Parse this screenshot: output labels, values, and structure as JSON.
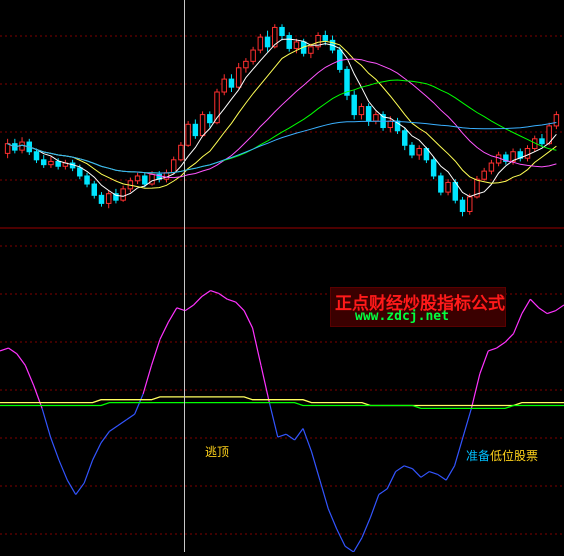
{
  "chart_data": [
    {
      "type": "candlestick",
      "panel": "price",
      "candles": [
        {
          "o": 1.0,
          "c": 1.6,
          "h": 1.9,
          "l": 0.7
        },
        {
          "o": 1.6,
          "c": 1.2,
          "h": 1.9,
          "l": 1.0
        },
        {
          "o": 1.2,
          "c": 1.7,
          "h": 2.0,
          "l": 1.0
        },
        {
          "o": 1.7,
          "c": 1.1,
          "h": 1.9,
          "l": 0.9
        },
        {
          "o": 1.1,
          "c": 0.6,
          "h": 1.3,
          "l": 0.4
        },
        {
          "o": 0.6,
          "c": 0.3,
          "h": 0.9,
          "l": 0.1
        },
        {
          "o": 0.3,
          "c": 0.5,
          "h": 0.8,
          "l": 0.1
        },
        {
          "o": 0.5,
          "c": 0.2,
          "h": 0.7,
          "l": 0.0
        },
        {
          "o": 0.2,
          "c": 0.4,
          "h": 0.6,
          "l": 0.0
        },
        {
          "o": 0.4,
          "c": 0.1,
          "h": 0.6,
          "l": -0.1
        },
        {
          "o": 0.1,
          "c": -0.4,
          "h": 0.3,
          "l": -0.6
        },
        {
          "o": -0.4,
          "c": -0.9,
          "h": -0.2,
          "l": -1.1
        },
        {
          "o": -0.9,
          "c": -1.6,
          "h": -0.7,
          "l": -1.8
        },
        {
          "o": -1.6,
          "c": -2.1,
          "h": -1.4,
          "l": -2.3
        },
        {
          "o": -2.1,
          "c": -1.5,
          "h": -1.3,
          "l": -2.4
        },
        {
          "o": -1.5,
          "c": -1.9,
          "h": -1.2,
          "l": -2.1
        },
        {
          "o": -1.9,
          "c": -1.2,
          "h": -1.0,
          "l": -2.0
        },
        {
          "o": -1.2,
          "c": -0.7,
          "h": -0.5,
          "l": -1.4
        },
        {
          "o": -0.7,
          "c": -0.4,
          "h": -0.2,
          "l": -0.9
        },
        {
          "o": -0.4,
          "c": -0.9,
          "h": -0.2,
          "l": -1.1
        },
        {
          "o": -0.9,
          "c": -0.3,
          "h": -0.1,
          "l": -1.0
        },
        {
          "o": -0.3,
          "c": -0.6,
          "h": -0.1,
          "l": -0.8
        },
        {
          "o": -0.6,
          "c": -0.2,
          "h": 0.0,
          "l": -0.8
        },
        {
          "o": -0.2,
          "c": 0.6,
          "h": 0.8,
          "l": -0.3
        },
        {
          "o": 0.6,
          "c": 1.5,
          "h": 1.7,
          "l": 0.5
        },
        {
          "o": 1.5,
          "c": 2.8,
          "h": 3.0,
          "l": 1.4
        },
        {
          "o": 2.8,
          "c": 2.1,
          "h": 3.1,
          "l": 1.9
        },
        {
          "o": 2.1,
          "c": 3.4,
          "h": 3.6,
          "l": 2.0
        },
        {
          "o": 3.4,
          "c": 2.9,
          "h": 3.6,
          "l": 2.6
        },
        {
          "o": 2.9,
          "c": 4.8,
          "h": 5.0,
          "l": 2.8
        },
        {
          "o": 4.8,
          "c": 5.6,
          "h": 5.9,
          "l": 4.6
        },
        {
          "o": 5.6,
          "c": 5.1,
          "h": 5.9,
          "l": 4.8
        },
        {
          "o": 5.1,
          "c": 6.3,
          "h": 6.6,
          "l": 5.0
        },
        {
          "o": 6.3,
          "c": 6.7,
          "h": 6.9,
          "l": 6.0
        },
        {
          "o": 6.7,
          "c": 7.4,
          "h": 7.6,
          "l": 6.5
        },
        {
          "o": 7.4,
          "c": 8.2,
          "h": 8.4,
          "l": 7.2
        },
        {
          "o": 8.2,
          "c": 7.6,
          "h": 8.6,
          "l": 7.3
        },
        {
          "o": 7.6,
          "c": 8.8,
          "h": 9.0,
          "l": 7.5
        },
        {
          "o": 8.8,
          "c": 8.3,
          "h": 9.0,
          "l": 8.0
        },
        {
          "o": 8.3,
          "c": 7.5,
          "h": 8.5,
          "l": 7.3
        },
        {
          "o": 7.5,
          "c": 7.9,
          "h": 8.1,
          "l": 7.2
        },
        {
          "o": 7.9,
          "c": 7.2,
          "h": 8.1,
          "l": 7.0
        },
        {
          "o": 7.2,
          "c": 7.6,
          "h": 7.8,
          "l": 6.9
        },
        {
          "o": 7.6,
          "c": 8.3,
          "h": 8.5,
          "l": 7.4
        },
        {
          "o": 8.3,
          "c": 8.0,
          "h": 8.6,
          "l": 7.7
        },
        {
          "o": 8.0,
          "c": 7.4,
          "h": 8.3,
          "l": 7.2
        },
        {
          "o": 7.4,
          "c": 6.2,
          "h": 7.6,
          "l": 6.0
        },
        {
          "o": 6.2,
          "c": 4.6,
          "h": 6.4,
          "l": 4.3
        },
        {
          "o": 4.6,
          "c": 3.4,
          "h": 4.9,
          "l": 3.1
        },
        {
          "o": 3.4,
          "c": 3.9,
          "h": 4.1,
          "l": 3.1
        },
        {
          "o": 3.9,
          "c": 3.0,
          "h": 4.1,
          "l": 2.7
        },
        {
          "o": 3.0,
          "c": 3.4,
          "h": 3.6,
          "l": 2.8
        },
        {
          "o": 3.4,
          "c": 2.6,
          "h": 3.6,
          "l": 2.4
        },
        {
          "o": 2.6,
          "c": 3.0,
          "h": 3.3,
          "l": 2.3
        },
        {
          "o": 3.0,
          "c": 2.4,
          "h": 3.2,
          "l": 2.2
        },
        {
          "o": 2.4,
          "c": 1.5,
          "h": 2.6,
          "l": 1.2
        },
        {
          "o": 1.5,
          "c": 0.9,
          "h": 1.7,
          "l": 0.7
        },
        {
          "o": 0.9,
          "c": 1.3,
          "h": 1.5,
          "l": 0.6
        },
        {
          "o": 1.3,
          "c": 0.6,
          "h": 1.4,
          "l": 0.4
        },
        {
          "o": 0.6,
          "c": -0.4,
          "h": 0.8,
          "l": -0.6
        },
        {
          "o": -0.4,
          "c": -1.4,
          "h": -0.2,
          "l": -1.6
        },
        {
          "o": -1.4,
          "c": -0.8,
          "h": -0.6,
          "l": -1.6
        },
        {
          "o": -0.8,
          "c": -1.9,
          "h": -0.6,
          "l": -2.1
        },
        {
          "o": -1.9,
          "c": -2.6,
          "h": -1.7,
          "l": -2.9
        },
        {
          "o": -2.6,
          "c": -1.7,
          "h": -1.5,
          "l": -2.8
        },
        {
          "o": -1.7,
          "c": -0.6,
          "h": -0.4,
          "l": -1.8
        },
        {
          "o": -0.6,
          "c": -0.1,
          "h": 0.1,
          "l": -0.7
        },
        {
          "o": -0.1,
          "c": 0.4,
          "h": 0.6,
          "l": -0.3
        },
        {
          "o": 0.4,
          "c": 0.9,
          "h": 1.1,
          "l": 0.2
        },
        {
          "o": 0.9,
          "c": 0.5,
          "h": 1.1,
          "l": 0.3
        },
        {
          "o": 0.5,
          "c": 1.1,
          "h": 1.3,
          "l": 0.3
        },
        {
          "o": 1.1,
          "c": 0.7,
          "h": 1.3,
          "l": 0.5
        },
        {
          "o": 0.7,
          "c": 1.3,
          "h": 1.5,
          "l": 0.5
        },
        {
          "o": 1.3,
          "c": 1.9,
          "h": 2.1,
          "l": 1.1
        },
        {
          "o": 1.9,
          "c": 1.6,
          "h": 2.2,
          "l": 1.4
        },
        {
          "o": 1.6,
          "c": 2.7,
          "h": 2.9,
          "l": 1.5
        },
        {
          "o": 2.7,
          "c": 3.4,
          "h": 3.6,
          "l": 2.5
        }
      ],
      "moving_averages": [
        {
          "color": "#ffffff",
          "period": 5
        },
        {
          "color": "#ffff55",
          "period": 10
        },
        {
          "color": "#ff55ff",
          "period": 20
        },
        {
          "color": "#00ff00",
          "period": 30
        },
        {
          "color": "#3ab0ff",
          "period": 60
        }
      ],
      "ylim": [
        -3.5,
        10.5
      ]
    },
    {
      "type": "line",
      "panel": "oscillator",
      "series": [
        {
          "role": "main",
          "color_high": "#ff33ff",
          "color_low": "#3355ff",
          "values": [
            60,
            61,
            59,
            55,
            48,
            40,
            30,
            22,
            15,
            10,
            14,
            22,
            28,
            32,
            34,
            36,
            38,
            45,
            55,
            64,
            70,
            75,
            74,
            76,
            79,
            81,
            80,
            78,
            77,
            74,
            68,
            55,
            42,
            30,
            31,
            29,
            33,
            25,
            15,
            5,
            -2,
            -8,
            -10,
            -5,
            2,
            10,
            12,
            18,
            20,
            19,
            16,
            18,
            17,
            15,
            20,
            30,
            40,
            52,
            60,
            61,
            63,
            66,
            73,
            78,
            75,
            73,
            74,
            76
          ]
        },
        {
          "role": "signal",
          "color": "#ffff60",
          "values": [
            42,
            42,
            42,
            42,
            42,
            42,
            42,
            42,
            42,
            42,
            42,
            42,
            43,
            43,
            43,
            43,
            43,
            43,
            43,
            44,
            44,
            44,
            44,
            44,
            44,
            44,
            44,
            44,
            44,
            44,
            43,
            43,
            43,
            43,
            43,
            43,
            43,
            42,
            42,
            42,
            42,
            42,
            42,
            42,
            41,
            41,
            41,
            41,
            41,
            41,
            41,
            41,
            41,
            41,
            41,
            41,
            41,
            41,
            41,
            41,
            41,
            41,
            42,
            42,
            42,
            42,
            42,
            42
          ]
        },
        {
          "role": "baseline",
          "color": "#00ff00",
          "values": [
            41,
            41,
            41,
            41,
            41,
            41,
            41,
            41,
            41,
            41,
            41,
            41,
            41,
            42,
            42,
            42,
            42,
            42,
            42,
            42,
            42,
            42,
            42,
            42,
            42,
            42,
            42,
            42,
            42,
            42,
            42,
            42,
            42,
            42,
            42,
            42,
            41,
            41,
            41,
            41,
            41,
            41,
            41,
            41,
            41,
            41,
            41,
            41,
            41,
            41,
            40,
            40,
            40,
            40,
            40,
            40,
            40,
            40,
            40,
            40,
            40,
            41,
            41,
            41,
            41,
            41,
            41,
            41
          ]
        }
      ],
      "ylim": [
        -10,
        100
      ]
    }
  ],
  "annotations": {
    "label_a": "逃顶",
    "label_b_part1": "准备",
    "label_b_part2": "低位股票"
  },
  "watermark": {
    "title": "正点财经炒股指标公式",
    "url": "www.zdcj.net"
  },
  "colors": {
    "up_candle": "#ff3030",
    "down_candle": "#00e5ff",
    "grid": "#800000",
    "crosshair": "#c8c8c8"
  }
}
